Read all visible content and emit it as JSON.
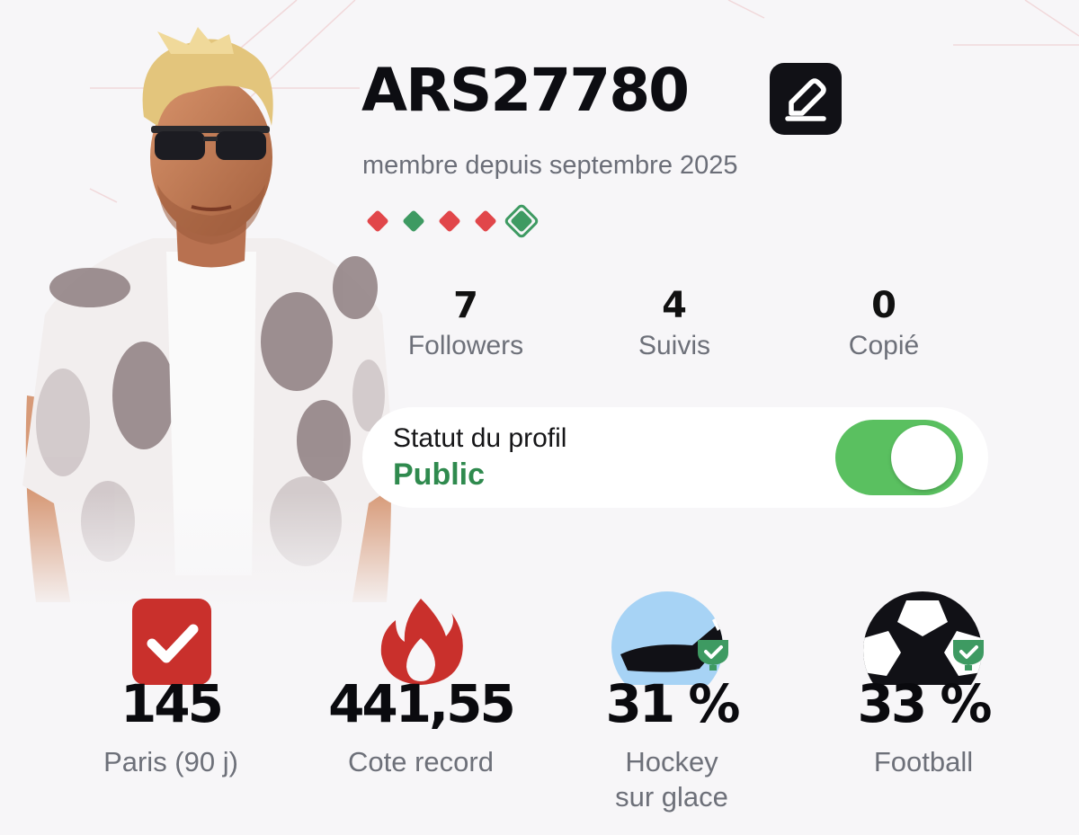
{
  "profile": {
    "username": "ARS27780",
    "member_since": "membre depuis septembre 2025",
    "recent_form": [
      "loss",
      "win",
      "loss",
      "loss",
      "win"
    ]
  },
  "stats": [
    {
      "value": "7",
      "label": "Followers"
    },
    {
      "value": "4",
      "label": "Suivis"
    },
    {
      "value": "0",
      "label": "Copié"
    }
  ],
  "status": {
    "title": "Statut du profil",
    "value": "Public",
    "toggle_on": true
  },
  "kpis": [
    {
      "value": "145",
      "label": "Paris (90 j)",
      "icon": "bets-check-icon"
    },
    {
      "value": "441,55",
      "label": "Cote record",
      "icon": "flame-icon"
    },
    {
      "value": "31 %",
      "label": "Hockey sur glace",
      "label_lines": [
        "Hockey",
        "sur glace"
      ],
      "icon": "hockey-stick-icon"
    },
    {
      "value": "33 %",
      "label": "Football",
      "icon": "football-icon"
    }
  ],
  "colors": {
    "win": "#3e9a62",
    "loss": "#e1464a",
    "public": "#2f8a4e",
    "toggle": "#5ac060",
    "accent_red": "#c9302c",
    "hockey_bg": "#a7d3f5"
  }
}
